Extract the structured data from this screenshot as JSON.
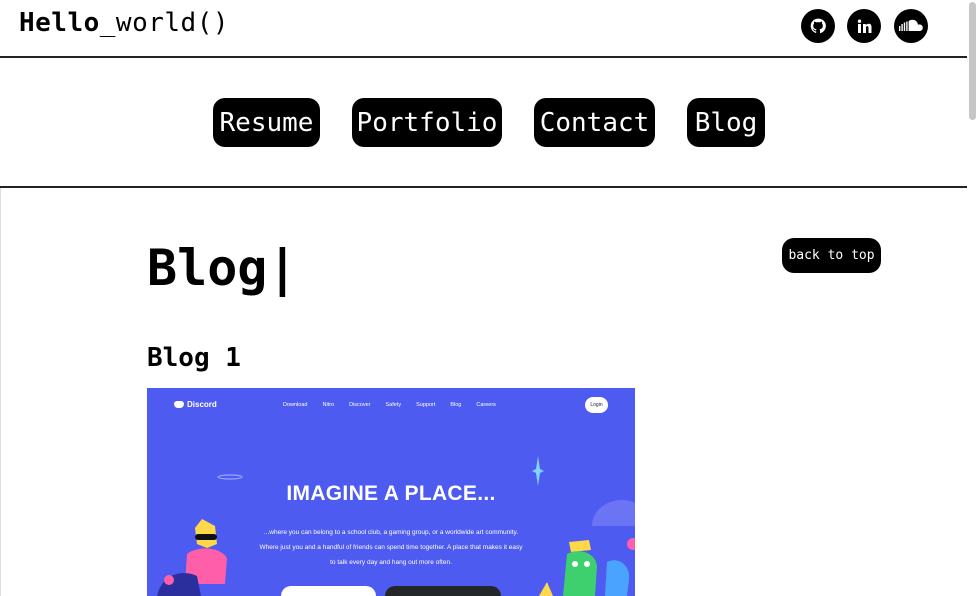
{
  "header": {
    "logo_bold": "Hello",
    "logo_rest": "_world()",
    "social": [
      {
        "icon": "github-icon"
      },
      {
        "icon": "linkedin-icon"
      },
      {
        "icon": "soundcloud-icon"
      }
    ]
  },
  "nav": {
    "items": [
      {
        "label": "Resume"
      },
      {
        "label": "Portfolio"
      },
      {
        "label": "Contact"
      },
      {
        "label": "Blog"
      }
    ]
  },
  "main": {
    "title": "Blog|",
    "back_to_top": "back to top",
    "posts": [
      {
        "title": "Blog 1",
        "screenshot": {
          "brand": "Discord",
          "menu": [
            "Download",
            "Nitro",
            "Discover",
            "Safety",
            "Support",
            "Blog",
            "Careers"
          ],
          "login": "Login",
          "headline": "IMAGINE A PLACE...",
          "lines": [
            "...where you can belong to a school club, a gaming group, or a worldwide art community.",
            "Where just you and a handful of friends can spend time together. A place that makes it easy",
            "to talk every day and hang out more often."
          ],
          "bg_color": "#4e5bf1"
        }
      }
    ]
  },
  "colors": {
    "accent": "#000000",
    "background": "#ffffff"
  }
}
